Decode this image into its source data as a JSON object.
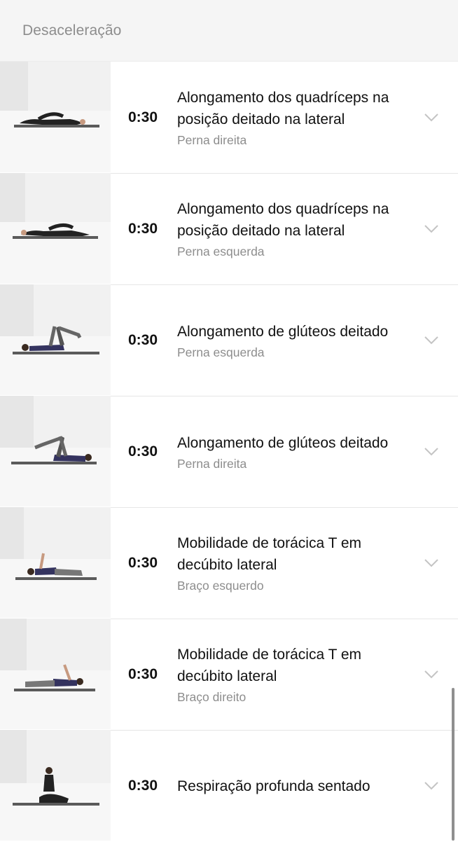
{
  "section": {
    "title": "Desaceleração"
  },
  "icons": {
    "chevron": "chevron-down-icon"
  },
  "colors": {
    "header_bg": "#f5f5f5",
    "subtitle": "#8d8d8d",
    "text": "#111111",
    "mat": "#5b5b5b",
    "shirt": "#34335f"
  },
  "exercises": [
    {
      "duration": "0:30",
      "title": "Alongamento dos quadríceps na posição deitado na lateral",
      "subtitle": "Perna direita",
      "pose": "side-lying-quad"
    },
    {
      "duration": "0:30",
      "title": "Alongamento dos quadríceps na posição deitado na lateral",
      "subtitle": "Perna esquerda",
      "pose": "side-lying-quad"
    },
    {
      "duration": "0:30",
      "title": "Alongamento de glúteos deitado",
      "subtitle": "Perna esquerda",
      "pose": "supine-glute"
    },
    {
      "duration": "0:30",
      "title": "Alongamento de glúteos deitado",
      "subtitle": "Perna direita",
      "pose": "supine-glute"
    },
    {
      "duration": "0:30",
      "title": "Mobilidade de torácica T em decúbito lateral",
      "subtitle": "Braço esquerdo",
      "pose": "thoracic-rotation"
    },
    {
      "duration": "0:30",
      "title": "Mobilidade de torácica T em decúbito lateral",
      "subtitle": "Braço direito",
      "pose": "thoracic-rotation"
    },
    {
      "duration": "0:30",
      "title": "Respiração profunda sentado",
      "subtitle": "",
      "pose": "seated-breathing"
    }
  ]
}
